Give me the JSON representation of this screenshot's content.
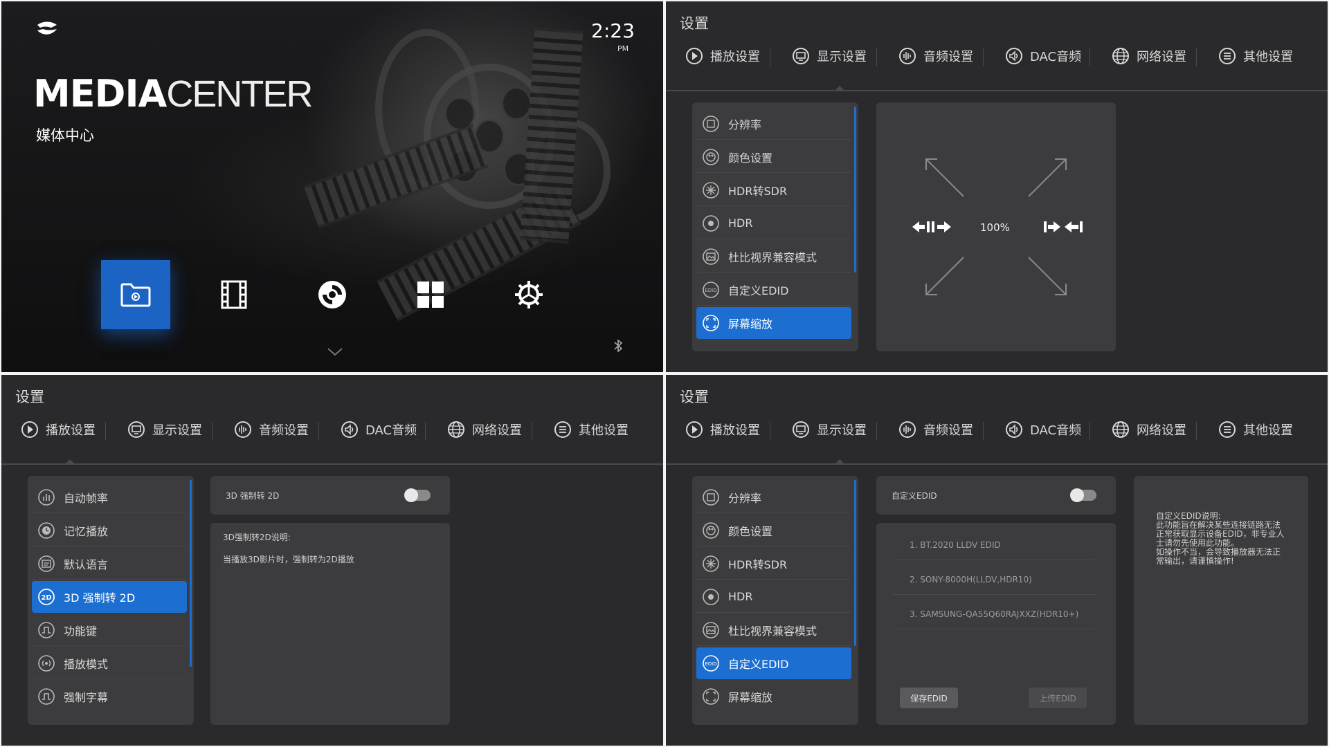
{
  "media_center": {
    "title_bold": "MEDIA",
    "title_light": "CENTER",
    "subtitle": "媒体中心",
    "time": "2:23",
    "ampm": "PM",
    "icons": [
      "folder-icon",
      "film-icon",
      "disc-icon",
      "apps-icon",
      "settings-icon"
    ],
    "accent": "#1c64c4"
  },
  "settings": {
    "title": "设置",
    "tabs": [
      "播放设置",
      "显示设置",
      "音频设置",
      "DAC音频",
      "网络设置",
      "其他设置"
    ]
  },
  "display_menu": [
    "分辨率",
    "颜色设置",
    "HDR转SDR",
    "HDR",
    "杜比视界兼容模式",
    "自定义EDID",
    "屏幕缩放"
  ],
  "zoom": {
    "value": "100%"
  },
  "playback_menu": [
    "自动帧率",
    "记忆播放",
    "默认语言",
    "3D 强制转 2D",
    "功能键",
    "播放模式",
    "强制字幕"
  ],
  "three_d": {
    "toggle_label": "3D 强制转 2D",
    "desc_title": "3D强制转2D说明:",
    "desc_body": "当播放3D影片时，强制转为2D播放"
  },
  "edid": {
    "toggle_label": "自定义EDID",
    "items": [
      "1. BT.2020 LLDV EDID",
      "2. SONY-8000H(LLDV,HDR10)",
      "3. SAMSUNG-QA55Q60RAJXXZ(HDR10+)"
    ],
    "save_button": "保存EDID",
    "upload_button": "上传EDID",
    "note_lines": [
      "自定义EDID说明:",
      "此功能旨在解决某些连接链路无法",
      "正常获取显示设备EDID，非专业人",
      "士请勿先使用此功能。",
      "如操作不当，会导致播放器无法正",
      "常输出，请谨慎操作!"
    ]
  },
  "colors": {
    "accent": "#1c6fd0",
    "panel": "#2a2a2c",
    "card": "#3c3c3e"
  }
}
